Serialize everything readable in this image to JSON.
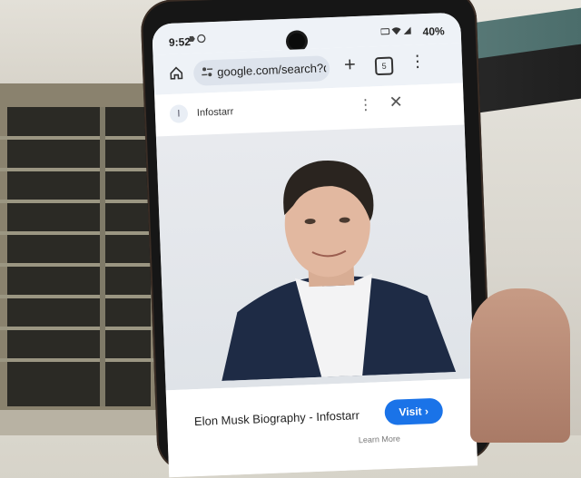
{
  "status": {
    "time": "9:52",
    "battery": "40%"
  },
  "browser": {
    "url": "google.com/search?q=e",
    "tab_count": "5",
    "source": {
      "favicon": "I",
      "name": "Infostarr"
    }
  },
  "result": {
    "title": "Elon Musk Biography - Infostarr",
    "visit_label": "Visit ›",
    "learn_more": "Learn More"
  },
  "icons": {
    "home": "home-icon",
    "tune": "tune-icon",
    "plus": "new-tab-icon",
    "tabs": "tabs-icon",
    "menu": "more-vert-icon",
    "close": "close-icon",
    "lens": "lens-icon"
  },
  "colors": {
    "accent": "#1a73e8",
    "toolbar": "#eef2f7"
  }
}
